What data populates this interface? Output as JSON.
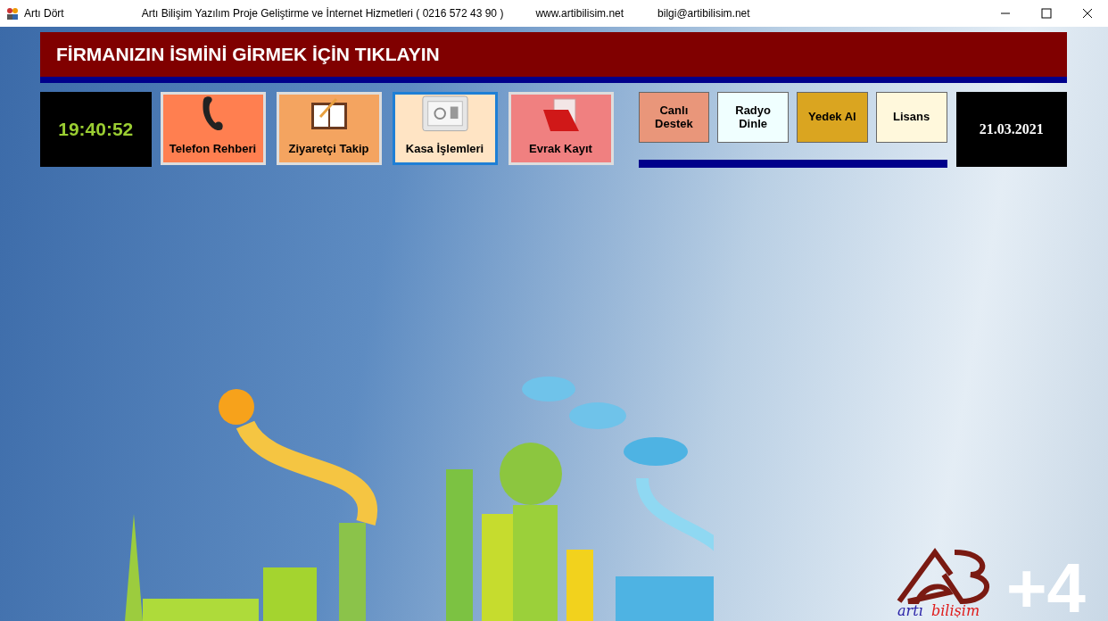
{
  "window": {
    "title": "Artı Dört",
    "company": "Artı Bilişim Yazılım Proje Geliştirme ve İnternet Hizmetleri ( 0216 572 43 90 )",
    "website": "www.artibilisim.net",
    "email": "bilgi@artibilisim.net"
  },
  "banner": {
    "text": "FİRMANIZIN İSMİNİ GİRMEK İÇİN TIKLAYIN"
  },
  "clock": "19:40:52",
  "tiles": [
    {
      "label": "Telefon Rehberi",
      "kind": "phone",
      "color": "#ff7f50",
      "selected": false
    },
    {
      "label": "Ziyaretçi Takip",
      "kind": "notebook",
      "color": "#f4a460",
      "selected": false
    },
    {
      "label": "Kasa İşlemleri",
      "kind": "safe",
      "color": "#ffe4c4",
      "selected": true
    },
    {
      "label": "Evrak Kayıt",
      "kind": "folder",
      "color": "#f08080",
      "selected": false
    }
  ],
  "small_buttons": [
    {
      "label": "Canlı Destek",
      "color": "#e9967a"
    },
    {
      "label": "Radyo Dinle",
      "color": "#f0ffff"
    },
    {
      "label": "Yedek Al",
      "color": "#daa520"
    },
    {
      "label": "Lisans",
      "color": "#fff8dc"
    }
  ],
  "date": "21.03.2021",
  "logo": {
    "text_a": "artı",
    "text_b": "bilişim"
  },
  "version": "+4"
}
